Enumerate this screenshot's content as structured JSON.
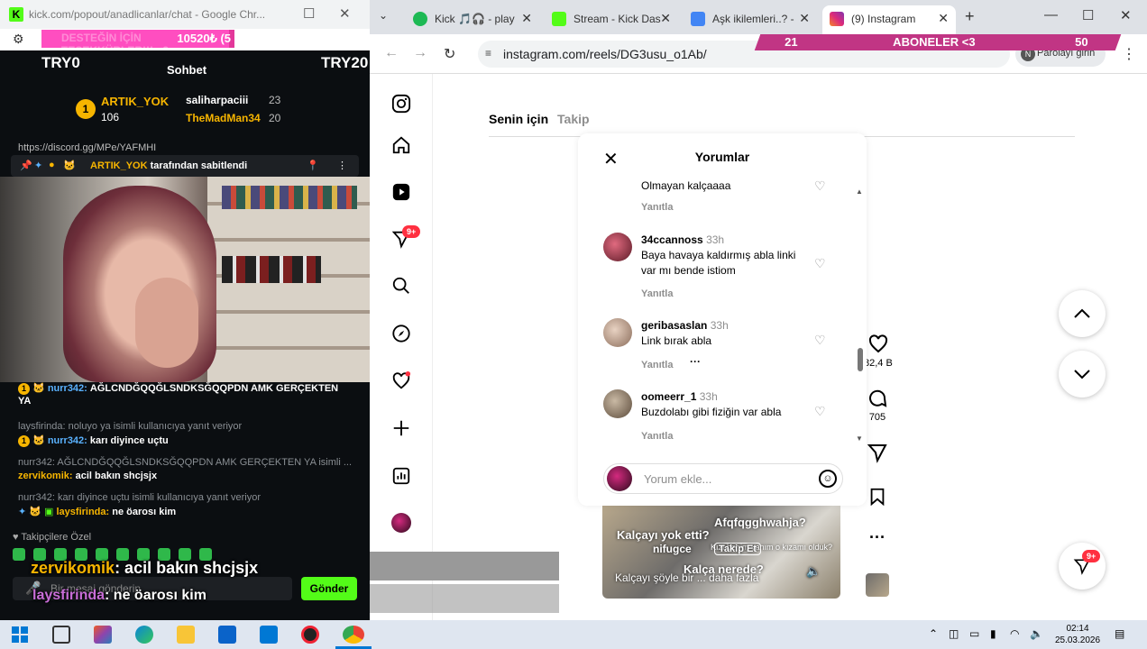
{
  "left_window": {
    "title_url": "kick.com/popout/anadlicanlar/chat - Google Chr...",
    "donation": {
      "amount": "10520₺ (5",
      "ghost_text": "DESTEĞİN İÇİN TEŞEKKÜRLER!!! <3",
      "progress": 0.97
    },
    "header": {
      "left_label": "TRY0",
      "center_label": "Sohbet",
      "right_label": "TRY20"
    },
    "leaderboard": [
      {
        "name": "ARTIK_YOK",
        "value": "106"
      },
      {
        "name": "saliharpaciii",
        "value": "23"
      },
      {
        "name": "TheMadMan34",
        "value": "20"
      }
    ],
    "discord_text": "https://discord.gg/MPe/YAFMHI",
    "pinned": {
      "user": "ARTIK_YOK",
      "suffix": "tarafından sabitlendi"
    },
    "messages": [
      {
        "user": "nurr342:",
        "text": "AĞLCNDĞQQĞLSNDKSĞQQPDN AMK GERÇEKTEN YA"
      },
      {
        "reply": "laysfirinda: noluyo ya isimli kullanıcıya yanıt veriyor"
      },
      {
        "user": "nurr342:",
        "text": "karı diyince uçtu"
      },
      {
        "reply": "nurr342: AĞLCNDĞQQĞLSNDKSĞQQPDN AMK GERÇEKTEN YA isimli ..."
      },
      {
        "user": "zervikomik:",
        "text": "acil bakın shcjsjx"
      },
      {
        "reply": "nurr342: karı diyince uçtu isimli kullanıcıya yanıt veriyor"
      },
      {
        "user": "laysfirinda:",
        "text": "ne öarosı kim"
      }
    ],
    "followers_label": "Takipçilere Özel",
    "overlay_top": {
      "user": "zervikomik",
      "text": ": acil bakın shcjsjx"
    },
    "overlay_bottom": {
      "user": "laysfirinda",
      "text": ": ne öarosı kim"
    },
    "input_placeholder": "Bir mesaj gönderin",
    "send_label": "Gönder"
  },
  "browser": {
    "tabs": [
      {
        "label": "Kick 🎵🎧 - play",
        "color": "#1db954"
      },
      {
        "label": "Stream - Kick Das",
        "color": "#53fc18"
      },
      {
        "label": "Aşk ikilemleri..? -",
        "color": "#4285f4"
      },
      {
        "label": "(9) Instagram",
        "color": "#e1306c",
        "active": true
      }
    ],
    "url": "instagram.com/reels/DG3usu_o1Ab/",
    "password_label": "Parolayı girin",
    "sub_banner": {
      "left": "21",
      "center": "ABONELER <3",
      "right": "50"
    }
  },
  "instagram": {
    "sidebar_badge": "9+",
    "feed_tabs": {
      "active": "Senin için",
      "other": "Takip"
    },
    "comments_title": "Yorumlar",
    "partial_comment": "Olmayan kalçaaaa",
    "reply_label": "Yanıtla",
    "comments": [
      {
        "user": "34ccannoss",
        "time": "33h",
        "text": "Baya havaya kaldırmış abla linki var mı bende istiom"
      },
      {
        "user": "geribasaslan",
        "time": "33h",
        "text": "Link bırak abla"
      },
      {
        "user": "oomeerr_1",
        "time": "33h",
        "text": "Buzdolabı gibi fiziğin var abla"
      }
    ],
    "add_comment_placeholder": "Yorum ekle...",
    "reel": {
      "caption1": "Kalçayı yok etti?",
      "caption2": "Afqfqgghwahja?",
      "caption3": "Kalça nerede?",
      "user": "nifugce",
      "follow_label": "Takip Et",
      "desc": "Kalçayı şöyle bir ... daha fazla",
      "sub_text": "Kızı benim yanım o kızamı olduk?"
    },
    "likes": "82,4 B",
    "comments_count": "705",
    "fab_badge": "9+"
  },
  "taskbar": {
    "time": "02:14",
    "date": "25.03.2026"
  }
}
